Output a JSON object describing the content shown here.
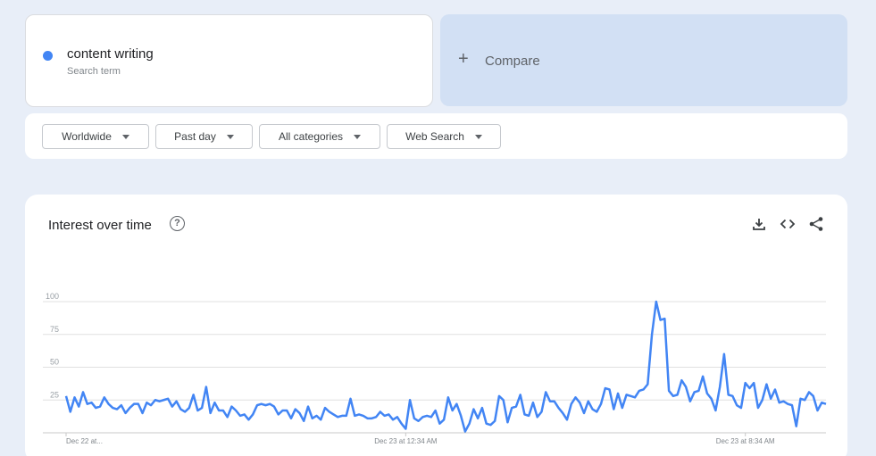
{
  "term": {
    "name": "content writing",
    "subtitle": "Search term",
    "color": "#4285f4"
  },
  "compare": {
    "plus": "+",
    "label": "Compare"
  },
  "filters": [
    {
      "label": "Worldwide"
    },
    {
      "label": "Past day"
    },
    {
      "label": "All categories"
    },
    {
      "label": "Web Search"
    }
  ],
  "chart_card": {
    "title": "Interest over time",
    "help_icon": "help-circle-icon",
    "tools": [
      "download-icon",
      "embed-code-icon",
      "share-icon"
    ]
  },
  "chart_data": {
    "type": "line",
    "title": "",
    "xlabel": "",
    "ylabel": "",
    "ylim": [
      0,
      100
    ],
    "yticks": [
      25,
      50,
      75,
      100
    ],
    "x_tick_labels": [
      {
        "index": 0,
        "label": "Dec 22 at..."
      },
      {
        "index": 80,
        "label": "Dec 23 at 12:34 AM"
      },
      {
        "index": 160,
        "label": "Dec 23 at 8:34 AM"
      }
    ],
    "grid": true,
    "series": [
      {
        "color": "#4285f4",
        "values": [
          28,
          16,
          27,
          20,
          31,
          22,
          23,
          19,
          20,
          27,
          22,
          19,
          18,
          21,
          15,
          19,
          22,
          22,
          15,
          23,
          21,
          25,
          24,
          25,
          26,
          20,
          24,
          18,
          16,
          19,
          29,
          17,
          19,
          35,
          15,
          23,
          17,
          17,
          12,
          20,
          17,
          13,
          14,
          10,
          14,
          21,
          22,
          21,
          22,
          20,
          14,
          17,
          17,
          11,
          18,
          15,
          9,
          20,
          11,
          13,
          10,
          19,
          16,
          14,
          12,
          13,
          13,
          26,
          13,
          14,
          13,
          11,
          11,
          12,
          16,
          13,
          14,
          10,
          12,
          7,
          3,
          25,
          11,
          9,
          12,
          13,
          12,
          17,
          7,
          10,
          27,
          17,
          22,
          13,
          1,
          7,
          18,
          11,
          19,
          7,
          6,
          9,
          28,
          25,
          8,
          19,
          20,
          29,
          14,
          13,
          23,
          12,
          16,
          31,
          24,
          24,
          19,
          15,
          10,
          22,
          27,
          23,
          15,
          24,
          18,
          16,
          22,
          34,
          33,
          18,
          30,
          19,
          29,
          28,
          27,
          32,
          33,
          37,
          75,
          100,
          86,
          87,
          32,
          28,
          29,
          40,
          35,
          24,
          31,
          32,
          43,
          30,
          26,
          17,
          35,
          60,
          29,
          28,
          21,
          19,
          38,
          34,
          38,
          19,
          25,
          37,
          26,
          33,
          23,
          24,
          22,
          21,
          5,
          26,
          25,
          31,
          28,
          17,
          23,
          22
        ]
      }
    ]
  }
}
